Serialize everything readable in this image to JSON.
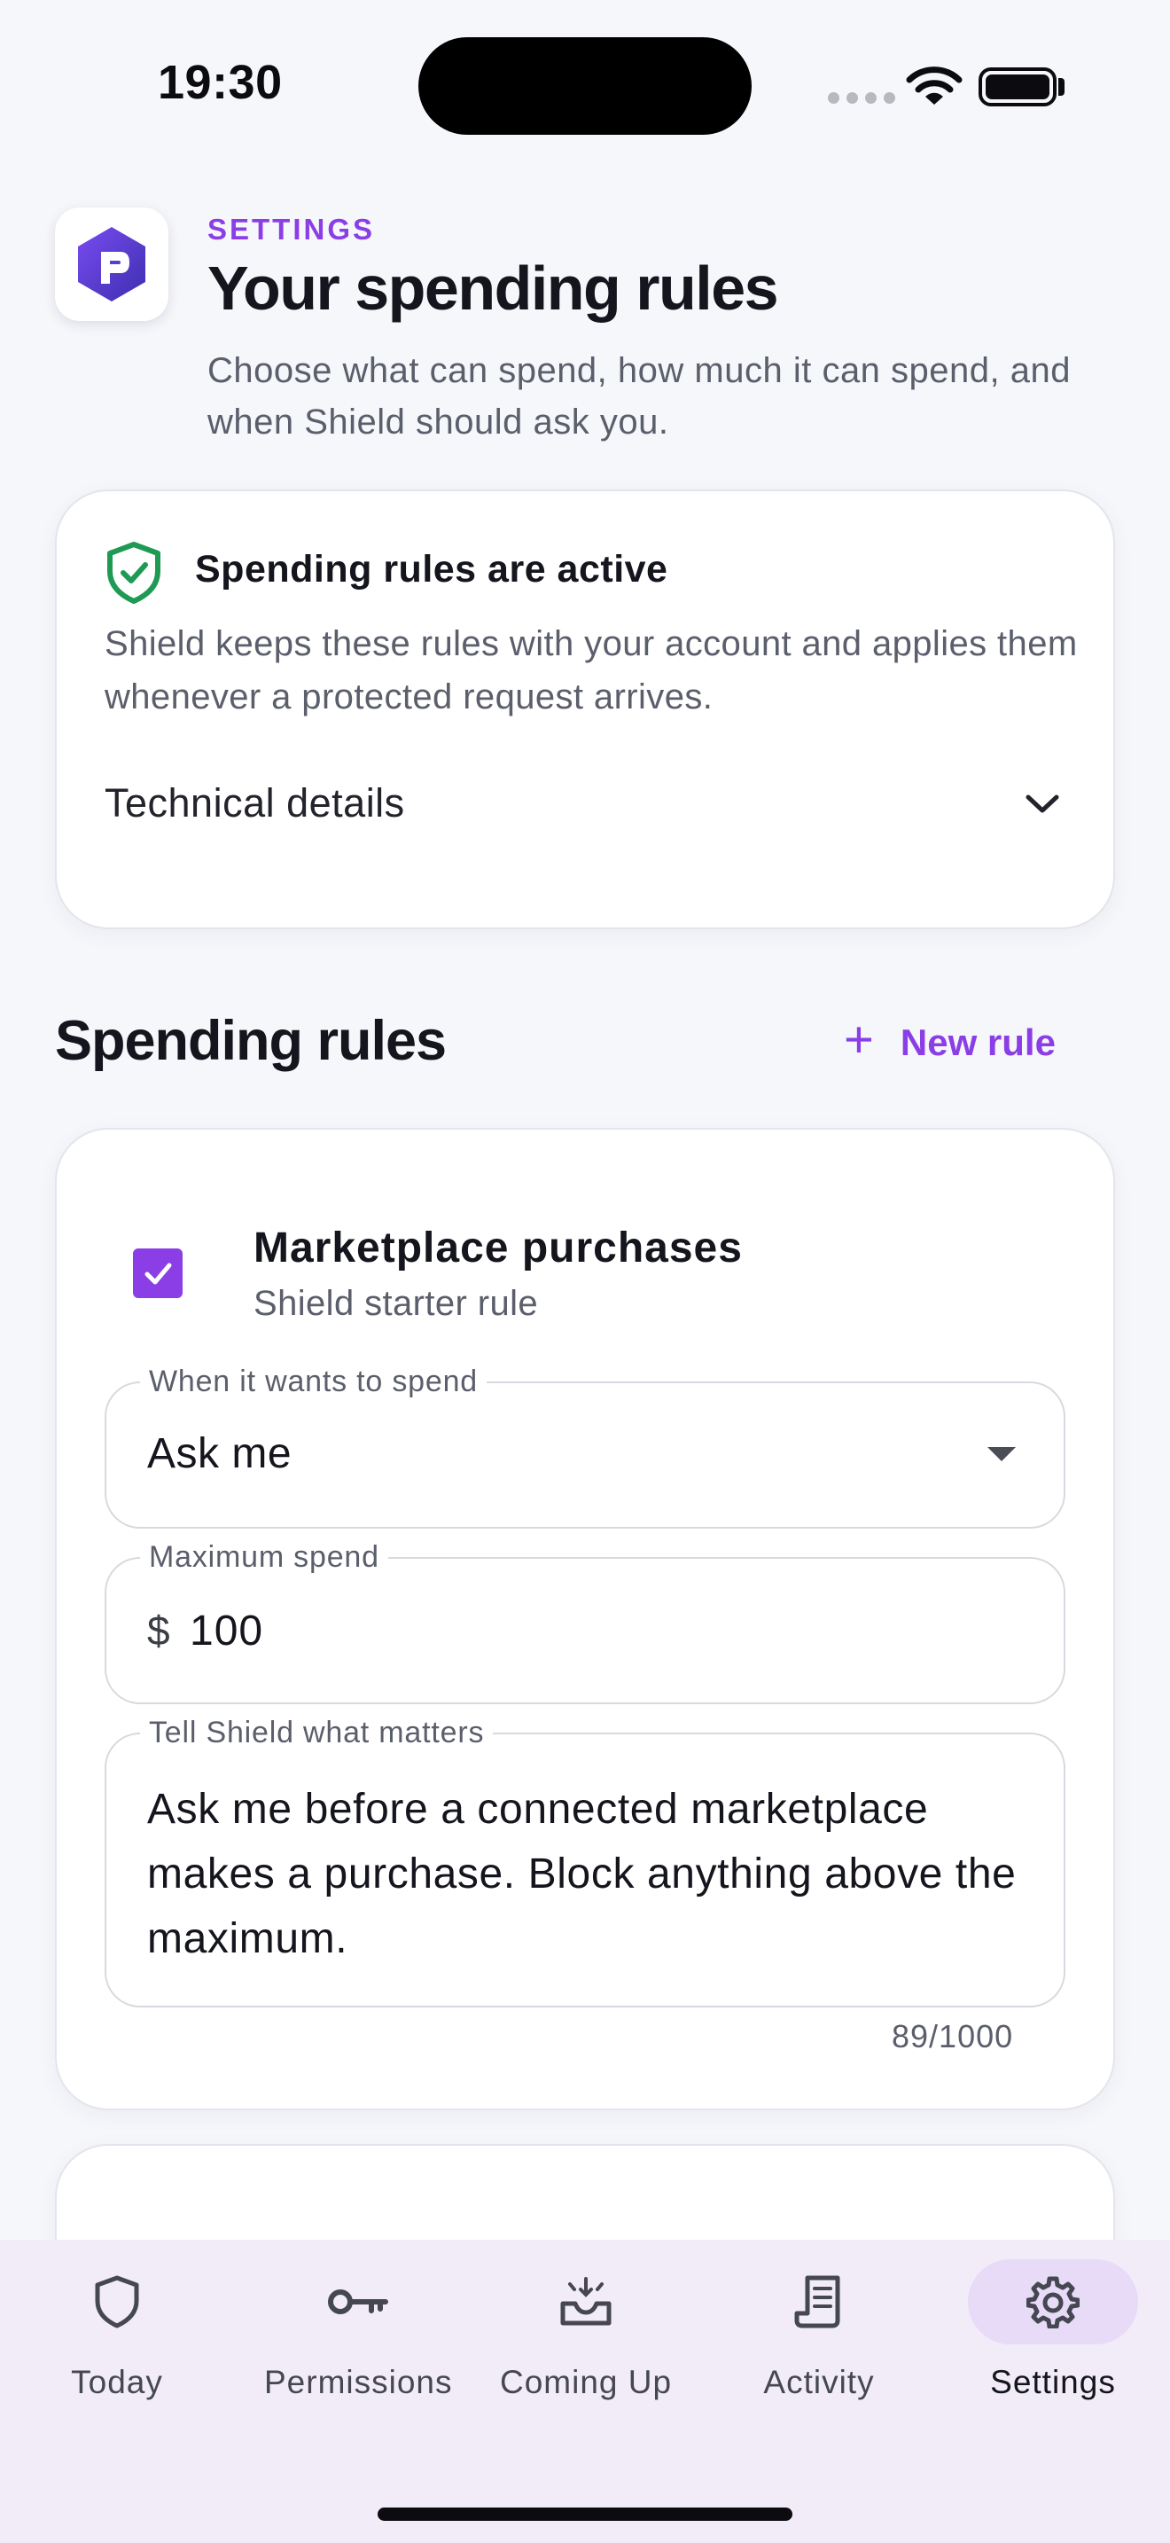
{
  "status_bar": {
    "time": "19:30",
    "icons": [
      "cellular-signal-icon",
      "wifi-icon",
      "battery-icon"
    ]
  },
  "header": {
    "logo_icon": "shield-logo-icon",
    "eyebrow": "SETTINGS",
    "title": "Your spending rules",
    "subtitle": "Choose what can spend, how much it can spend, and when Shield should ask you."
  },
  "status_card": {
    "icon": "shield-check-icon",
    "title": "Spending rules are active",
    "body": "Shield keeps these rules with your account and applies them whenever a protected request arrives.",
    "details_label": "Technical details",
    "details_expanded": false
  },
  "rules_section": {
    "title": "Spending rules",
    "new_rule_label": "New rule"
  },
  "rules": [
    {
      "enabled": true,
      "name": "Marketplace purchases",
      "subtitle": "Shield starter rule",
      "mode_label": "When it wants to spend",
      "mode_value": "Ask me",
      "max_label": "Maximum spend",
      "currency_symbol": "$",
      "max_value": "100",
      "note_label": "Tell Shield what matters",
      "note_value": "Ask me before a connected marketplace makes a purchase. Block anything above the maximum.",
      "char_count": "89/1000"
    }
  ],
  "tabs": [
    {
      "label": "Today",
      "icon": "shield-icon",
      "active": false
    },
    {
      "label": "Permissions",
      "icon": "key-icon",
      "active": false
    },
    {
      "label": "Coming Up",
      "icon": "inbox-icon",
      "active": false
    },
    {
      "label": "Activity",
      "icon": "receipt-icon",
      "active": false
    },
    {
      "label": "Settings",
      "icon": "gear-icon",
      "active": true
    }
  ],
  "colors": {
    "accent": "#8b3ee6",
    "background": "#f6f7fb",
    "success": "#1f9a55",
    "tab_active_pill": "#e7dbf8"
  }
}
